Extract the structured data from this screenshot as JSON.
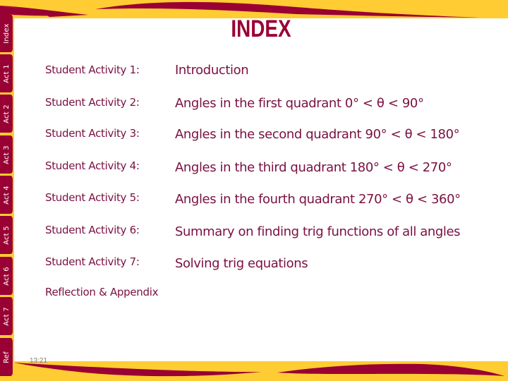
{
  "title": "INDEX",
  "tabs": [
    {
      "label": "Index"
    },
    {
      "label": "Act 1"
    },
    {
      "label": "Act 2"
    },
    {
      "label": "Act 3"
    },
    {
      "label": "Act 4"
    },
    {
      "label": "Act 5"
    },
    {
      "label": "Act 6"
    },
    {
      "label": "Act 7"
    },
    {
      "label": "Ref"
    }
  ],
  "activities": [
    {
      "label": "Student Activity 1:",
      "description": "Introduction"
    },
    {
      "label": "Student Activity 2:",
      "description": "Angles in the first quadrant 0° < θ < 90°"
    },
    {
      "label": "Student Activity 3:",
      "description": "Angles in the second quadrant 90° < θ < 180°"
    },
    {
      "label": "Student Activity 4:",
      "description": "Angles in the third quadrant 180° < θ < 270°"
    },
    {
      "label": "Student Activity 5:",
      "description": "Angles in the fourth quadrant 270° < θ < 360°"
    },
    {
      "label": "Student Activity 6:",
      "description": "Summary on finding trig functions of all angles"
    },
    {
      "label": "Student Activity 7:",
      "description": "Solving trig equations"
    }
  ],
  "reflection": "Reflection & Appendix",
  "footer_date": "13:21",
  "colors": {
    "maroon": "#990033",
    "gold": "#ffcc33",
    "text": "#7a1040"
  }
}
